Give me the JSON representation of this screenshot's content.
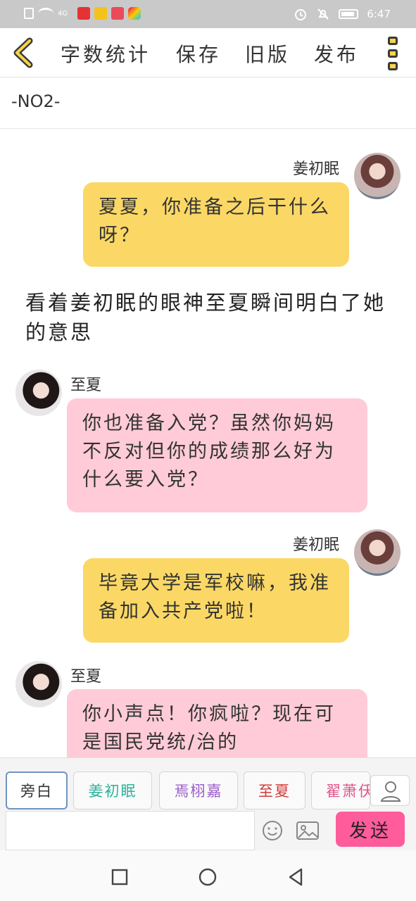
{
  "status_bar": {
    "data_label": "4G",
    "time": "6:47"
  },
  "toolbar": {
    "items": [
      "字数统计",
      "保存",
      "旧版",
      "发布"
    ]
  },
  "chapter": {
    "title": "-NO2-"
  },
  "messages": [
    {
      "type": "bubble",
      "side": "right",
      "speaker": "姜初眠",
      "color": "#fbd865",
      "text": "夏夏，你准备之后干什么呀？"
    },
    {
      "type": "narration",
      "text": "看着姜初眠的眼神至夏瞬间明白了她的意思"
    },
    {
      "type": "bubble",
      "side": "left",
      "speaker": "至夏",
      "color": "#ffcbd8",
      "text": "你也准备入党？虽然你妈妈不反对但你的成绩那么好为什么要入党？"
    },
    {
      "type": "bubble",
      "side": "right",
      "speaker": "姜初眠",
      "color": "#fbd865",
      "text": "毕竟大学是军校嘛，我准备加入共产党啦！"
    },
    {
      "type": "bubble",
      "side": "left",
      "speaker": "至夏",
      "color": "#ffcbd8",
      "text": "你小声点！你疯啦？现在可是国民党统/治的"
    }
  ],
  "characters": [
    {
      "label": "旁白",
      "color": "#333333",
      "active": true
    },
    {
      "label": "姜初眠",
      "color": "#2bb39a",
      "active": false
    },
    {
      "label": "焉栩嘉",
      "color": "#9b5bc9",
      "active": false
    },
    {
      "label": "至夏",
      "color": "#d43a3a",
      "active": false
    },
    {
      "label": "翟萧仸",
      "color": "#e0558a",
      "active": false
    }
  ],
  "input": {
    "placeholder": "",
    "value": ""
  },
  "send_label": "发送"
}
